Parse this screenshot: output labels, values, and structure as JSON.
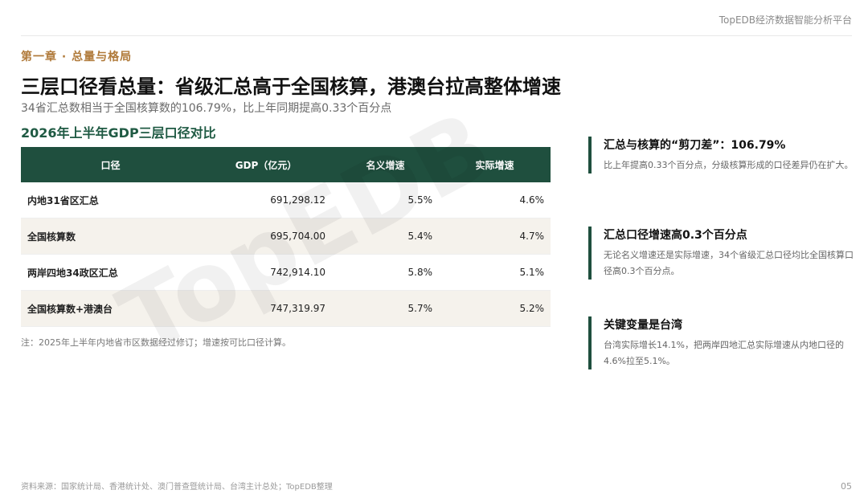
{
  "header": {
    "brand": "TopEDB经济数据智能分析平台"
  },
  "chapter": "第一章 · 总量与格局",
  "title": "三层口径看总量：省级汇总高于全国核算，港澳台拉高整体增速",
  "subtitle": "34省汇总数相当于全国核算数的106.79%，比上年同期提高0.33个百分点",
  "table": {
    "title": "2026年上半年GDP三层口径对比",
    "headers": [
      "口径",
      "GDP（亿元）",
      "名义增速",
      "实际增速"
    ],
    "rows": [
      {
        "name": "内地31省区汇总",
        "gdp": "691,298.12",
        "nominal": "5.5%",
        "real": "4.6%"
      },
      {
        "name": "全国核算数",
        "gdp": "695,704.00",
        "nominal": "5.4%",
        "real": "4.7%"
      },
      {
        "name": "两岸四地34政区汇总",
        "gdp": "742,914.10",
        "nominal": "5.8%",
        "real": "5.1%"
      },
      {
        "name": "全国核算数+港澳台",
        "gdp": "747,319.97",
        "nominal": "5.7%",
        "real": "5.2%"
      }
    ],
    "note": "注：2025年上半年内地省市区数据经过修订；增速按可比口径计算。"
  },
  "watermark": "TopEDB",
  "insights": [
    {
      "title": "汇总与核算的“剪刀差”：106.79%",
      "body": "比上年提高0.33个百分点，分级核算形成的口径差异仍在扩大。"
    },
    {
      "title": "汇总口径增速高0.3个百分点",
      "body": "无论名义增速还是实际增速，34个省级汇总口径均比全国核算口径高0.3个百分点。"
    },
    {
      "title": "关键变量是台湾",
      "body": "台湾实际增长14.1%，把两岸四地汇总实际增速从内地口径的4.6%拉至5.1%。"
    }
  ],
  "footer": {
    "source": "资料来源：国家统计局、香港统计处、澳门普查暨统计局、台湾主计总处；TopEDB整理",
    "page": "05"
  },
  "colors": {
    "accent_green": "#1f4f3e",
    "chapter_gold": "#b07a3a",
    "row_alt": "#f5f2ec"
  }
}
